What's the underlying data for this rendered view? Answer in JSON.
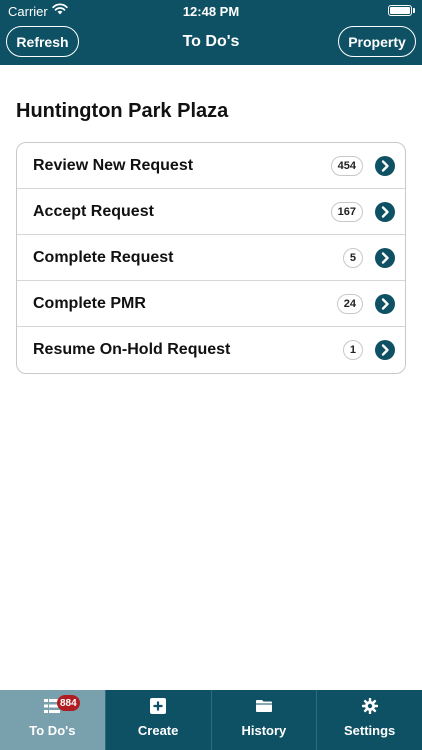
{
  "status_bar": {
    "carrier": "Carrier",
    "time": "12:48 PM",
    "icons": [
      "wifi-icon",
      "battery-icon"
    ]
  },
  "nav": {
    "title": "To Do's",
    "refresh_label": "Refresh",
    "property_label": "Property"
  },
  "property": {
    "name": "Huntington Park Plaza"
  },
  "todos": [
    {
      "label": "Review New Request",
      "count": "454"
    },
    {
      "label": "Accept Request",
      "count": "167"
    },
    {
      "label": "Complete Request",
      "count": "5"
    },
    {
      "label": "Complete PMR",
      "count": "24"
    },
    {
      "label": "Resume On-Hold Request",
      "count": "1"
    }
  ],
  "tabs": [
    {
      "label": "To Do's",
      "icon": "list-grid-icon",
      "badge": "884",
      "active": true
    },
    {
      "label": "Create",
      "icon": "plus-square-icon"
    },
    {
      "label": "History",
      "icon": "folder-icon"
    },
    {
      "label": "Settings",
      "icon": "gear-icon"
    }
  ],
  "colors": {
    "primary": "#0f5164",
    "active_tab": "#78a0ad",
    "badge": "#b01e24"
  }
}
